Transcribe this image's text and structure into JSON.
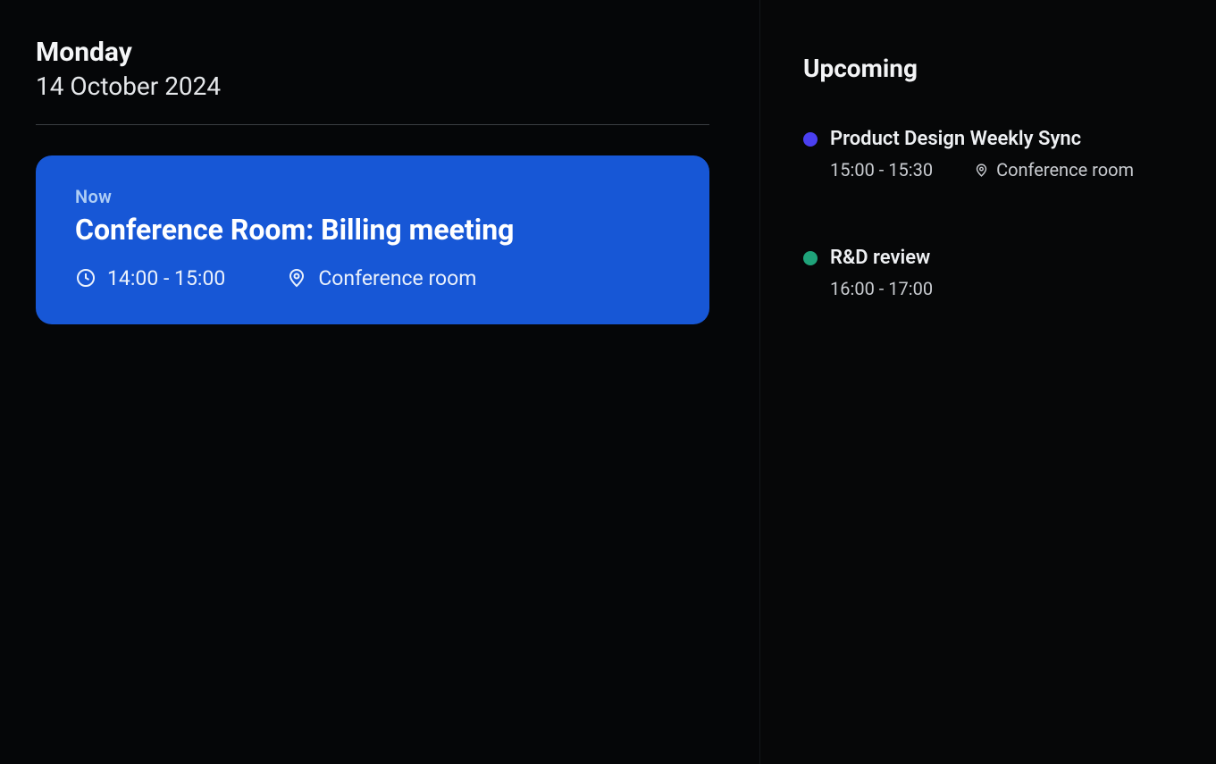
{
  "header": {
    "day_name": "Monday",
    "date": "14 October 2024"
  },
  "current": {
    "now_label": "Now",
    "title": "Conference Room: Billing meeting",
    "time": "14:00 - 15:00",
    "location": "Conference room",
    "accent": "#1757d6"
  },
  "sidebar": {
    "title": "Upcoming",
    "items": [
      {
        "title": "Product Design Weekly Sync",
        "time": "15:00 - 15:30",
        "location": "Conference room",
        "dot_color": "#4a3ff0"
      },
      {
        "title": "R&D review",
        "time": "16:00 - 17:00",
        "location": "",
        "dot_color": "#1fa37a"
      }
    ]
  },
  "icons": {
    "clock": "clock-icon",
    "pin": "location-pin-icon"
  }
}
